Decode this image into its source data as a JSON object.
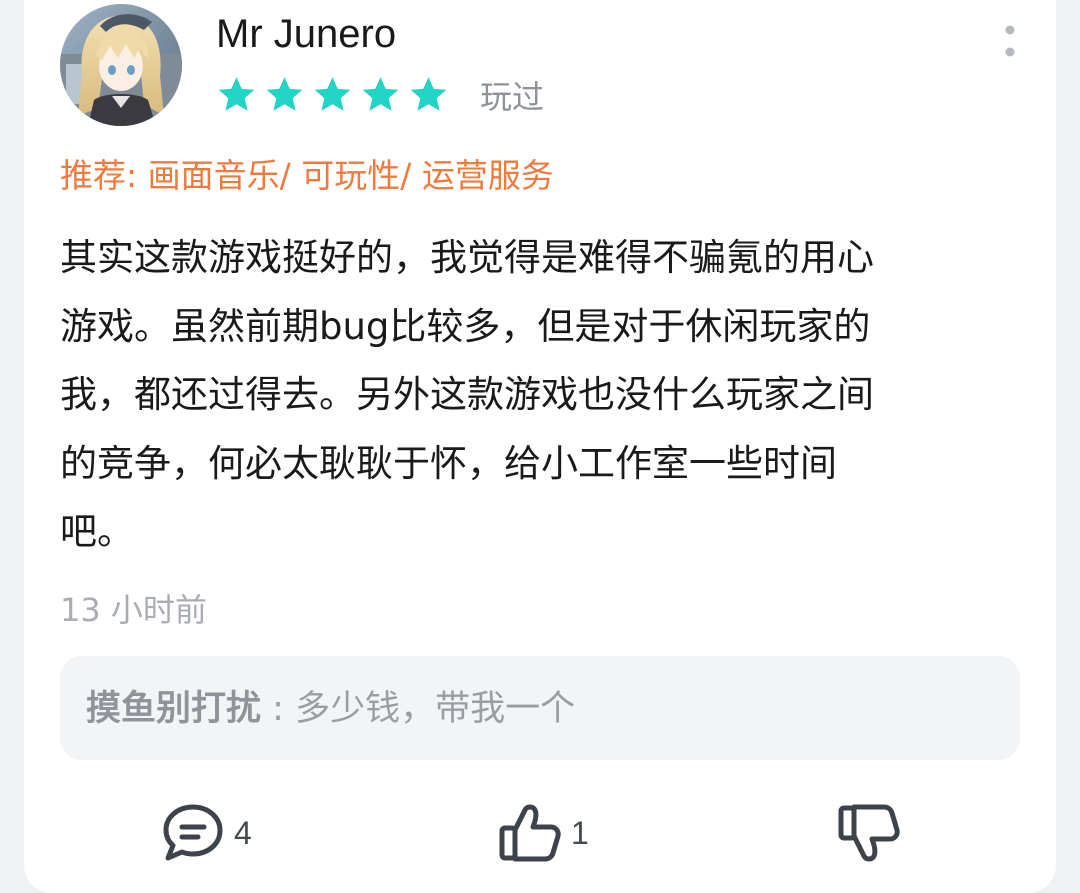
{
  "review": {
    "username": "Mr Junero",
    "rating": 5,
    "rating_max": 5,
    "status": "玩过",
    "recommend": "推荐: 画面音乐/ 可玩性/ 运营服务",
    "body_lines": [
      "其实这款游戏挺好的，我觉得是难得不骗氪的用心",
      "游戏。虽然前期bug比较多，但是对于休闲玩家的",
      "我，都还过得去。另外这款游戏也没什么玩家之间",
      "的竞争，何必太耿耿于怀，给小工作室一些时间",
      "吧。"
    ],
    "timestamp": "13 小时前"
  },
  "reply": {
    "author": "摸鱼别打扰",
    "separator": " : ",
    "text": "多少钱，带我一个"
  },
  "actions": {
    "comment_count": "4",
    "like_count": "1"
  },
  "colors": {
    "star": "#21d4c6",
    "recommend": "#f07a3d",
    "meta": "#a9adb3",
    "reply_bg": "#f3f4f6"
  },
  "icons": {
    "more": "more-vertical-icon",
    "comment": "comment-bubble-icon",
    "like": "thumbs-up-icon",
    "dislike": "thumbs-down-icon",
    "star": "star-icon"
  }
}
